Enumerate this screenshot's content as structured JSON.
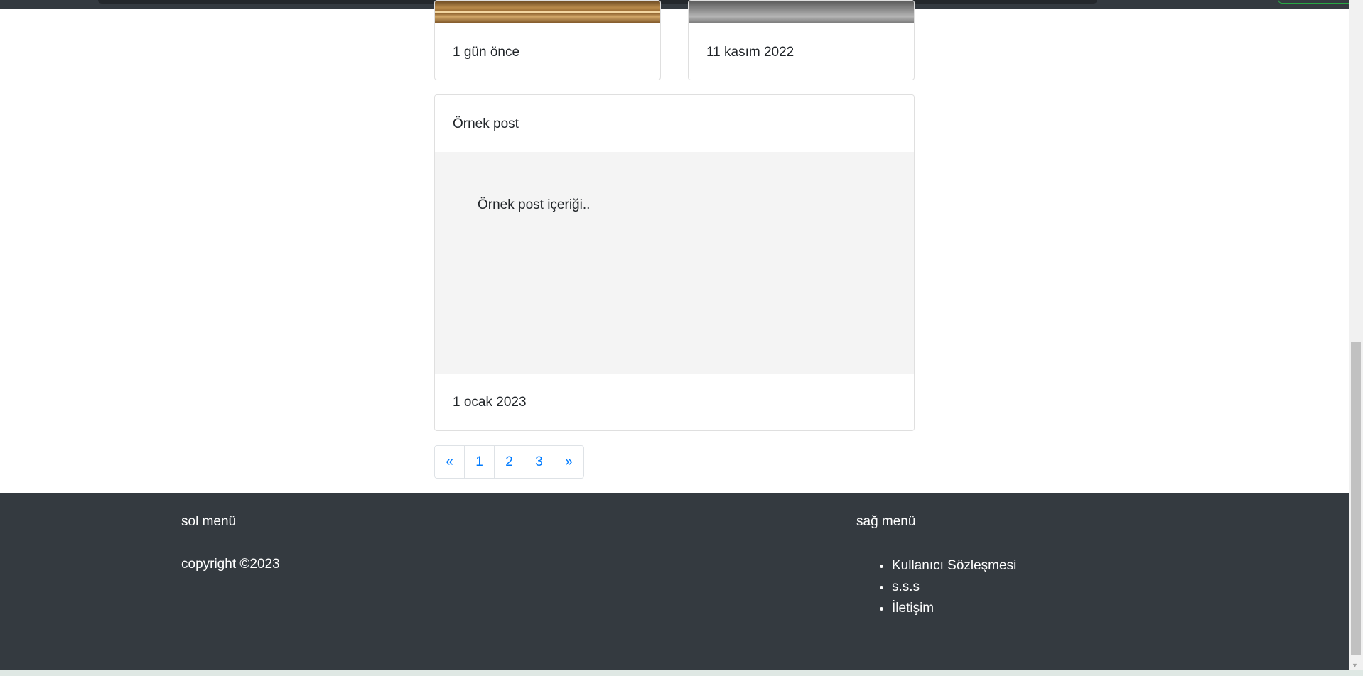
{
  "cards": [
    {
      "date": "1 gün önce"
    },
    {
      "date": "11 kasım 2022"
    }
  ],
  "post": {
    "title": "Örnek post",
    "content": "Örnek post içeriği..",
    "date": "1 ocak 2023"
  },
  "pagination": {
    "prev": "«",
    "pages": [
      "1",
      "2",
      "3"
    ],
    "next": "»"
  },
  "footer": {
    "left_heading": "sol menü",
    "copyright": "copyright ©2023",
    "right_heading": "sağ menü",
    "links": [
      "Kullanıcı Sözleşmesi",
      "s.s.s",
      "İletişim"
    ]
  },
  "colors": {
    "footer_bg": "#343a40",
    "link": "#007bff",
    "post_body_bg": "#f4f4f4"
  }
}
